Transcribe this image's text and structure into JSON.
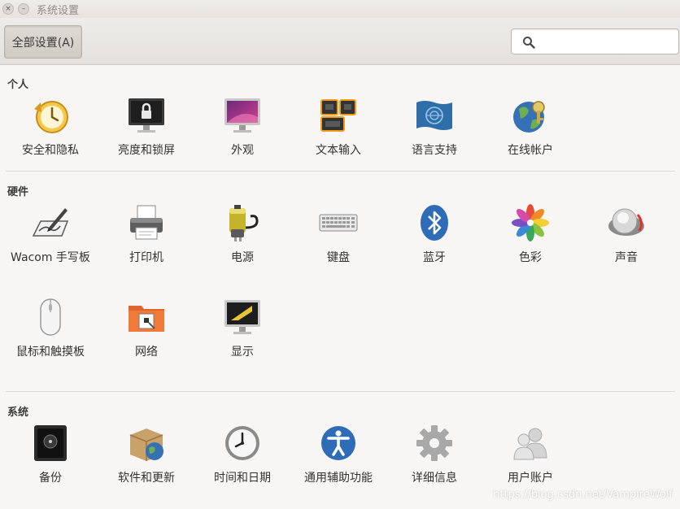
{
  "window": {
    "title": "系统设置",
    "close_glyph": "×",
    "minimize_glyph": "–"
  },
  "toolbar": {
    "all_settings_label": "全部设置(A)",
    "search_placeholder": ""
  },
  "sections": [
    {
      "title": "个人",
      "items": [
        {
          "label": "安全和隐私",
          "icon": "security-privacy-icon"
        },
        {
          "label": "亮度和锁屏",
          "icon": "brightness-lock-icon"
        },
        {
          "label": "外观",
          "icon": "appearance-icon"
        },
        {
          "label": "文本输入",
          "icon": "text-entry-icon"
        },
        {
          "label": "语言支持",
          "icon": "language-support-icon"
        },
        {
          "label": "在线帐户",
          "icon": "online-accounts-icon"
        }
      ]
    },
    {
      "title": "硬件",
      "items": [
        {
          "label": "Wacom 手写板",
          "icon": "wacom-tablet-icon"
        },
        {
          "label": "打印机",
          "icon": "printer-icon"
        },
        {
          "label": "电源",
          "icon": "power-icon"
        },
        {
          "label": "键盘",
          "icon": "keyboard-icon"
        },
        {
          "label": "蓝牙",
          "icon": "bluetooth-icon"
        },
        {
          "label": "色彩",
          "icon": "color-icon"
        },
        {
          "label": "声音",
          "icon": "sound-icon"
        },
        {
          "label": "鼠标和触摸板",
          "icon": "mouse-touchpad-icon"
        },
        {
          "label": "网络",
          "icon": "network-icon"
        },
        {
          "label": "显示",
          "icon": "display-icon"
        }
      ]
    },
    {
      "title": "系统",
      "items": [
        {
          "label": "备份",
          "icon": "backup-icon"
        },
        {
          "label": "软件和更新",
          "icon": "software-updates-icon"
        },
        {
          "label": "时间和日期",
          "icon": "time-date-icon"
        },
        {
          "label": "通用辅助功能",
          "icon": "universal-access-icon"
        },
        {
          "label": "详细信息",
          "icon": "details-icon"
        },
        {
          "label": "用户账户",
          "icon": "user-accounts-icon"
        }
      ]
    }
  ],
  "watermark": "https://blog.csdn.net/VampireWolf"
}
